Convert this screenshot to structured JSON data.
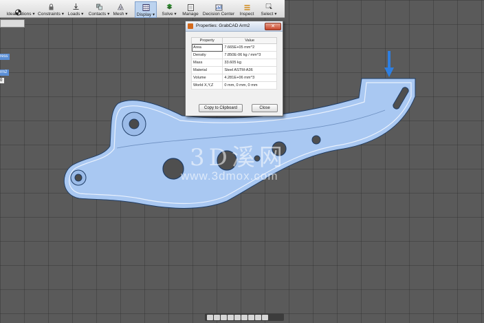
{
  "ribbon": {
    "items": [
      {
        "label": "Idealizations",
        "dropdown": true,
        "icon": "idealizations-icon"
      },
      {
        "label": "Constraints",
        "dropdown": true,
        "icon": "lock-icon"
      },
      {
        "label": "Loads",
        "dropdown": true,
        "icon": "load-icon"
      },
      {
        "label": "Contacts",
        "dropdown": true,
        "icon": "contacts-icon"
      },
      {
        "label": "Mesh",
        "dropdown": true,
        "icon": "mesh-icon"
      },
      {
        "label": "Display",
        "dropdown": true,
        "icon": "display-icon"
      },
      {
        "label": "Solve",
        "dropdown": true,
        "icon": "solve-icon"
      },
      {
        "label": "Manage",
        "dropdown": false,
        "icon": "manage-icon"
      },
      {
        "label": "Decision Center",
        "dropdown": false,
        "icon": "decision-center-icon"
      },
      {
        "label": "Inspect",
        "dropdown": false,
        "icon": "inspect-icon"
      },
      {
        "label": "Select",
        "dropdown": true,
        "icon": "select-icon"
      }
    ]
  },
  "tree": {
    "item1": "ress",
    "item2": "rm2",
    "value": "0"
  },
  "dialog": {
    "title": "Properties: GrabCAD Arm2",
    "close_glyph": "✕",
    "headers": {
      "property": "Property",
      "value": "Value"
    },
    "rows": [
      {
        "property": "Area",
        "value": "7.665E+05 mm^2"
      },
      {
        "property": "Density",
        "value": "7.850E-06 kg / mm^3"
      },
      {
        "property": "Mass",
        "value": "33.605 kg"
      },
      {
        "property": "Material",
        "value": "Steel ASTM-A36"
      },
      {
        "property": "Volume",
        "value": "4.281E+06 mm^3"
      },
      {
        "property": "World X,Y,Z",
        "value": "0 mm, 0 mm, 0 mm"
      }
    ],
    "copy_button": "Copy to Clipboard",
    "close_button": "Close"
  },
  "watermark": {
    "chinese": "3D溪网",
    "url": "www.3dmox.com"
  },
  "colors": {
    "part_fill": "#a9c8f2",
    "part_edge": "#1f3d66",
    "load_arrow": "#2f7fe0",
    "viewport_bg": "#5a5a5a"
  }
}
